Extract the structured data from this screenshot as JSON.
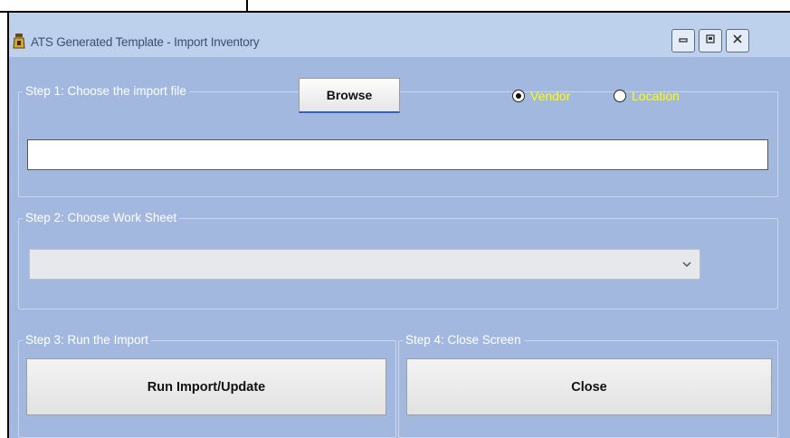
{
  "window": {
    "title": "ATS Generated Template - Import Inventory",
    "controls": {
      "minimize": "minimize",
      "maximize": "maximize",
      "close": "close"
    }
  },
  "step1": {
    "label": "Step 1: Choose the import file",
    "browse_label": "Browse",
    "file_path_value": "",
    "radio_options": [
      {
        "label": "Vendor",
        "selected": true
      },
      {
        "label": "Location",
        "selected": false
      }
    ]
  },
  "step2": {
    "label": "Step 2:  Choose Work Sheet",
    "worksheet_value": ""
  },
  "step3": {
    "label": "Step 3:  Run the Import",
    "run_label": "Run Import/Update"
  },
  "step4": {
    "label": "Step 4: Close Screen",
    "close_label": "Close"
  },
  "colors": {
    "background": "#a3b8df",
    "titlebar": "#bdd0ec",
    "radio_label": "#ffff00",
    "group_label": "#ffffff"
  },
  "icons": {
    "app": "app-icon",
    "minimize": "minimize-icon",
    "maximize": "maximize-icon",
    "close": "close-icon",
    "dropdown": "chevron-down-icon"
  }
}
